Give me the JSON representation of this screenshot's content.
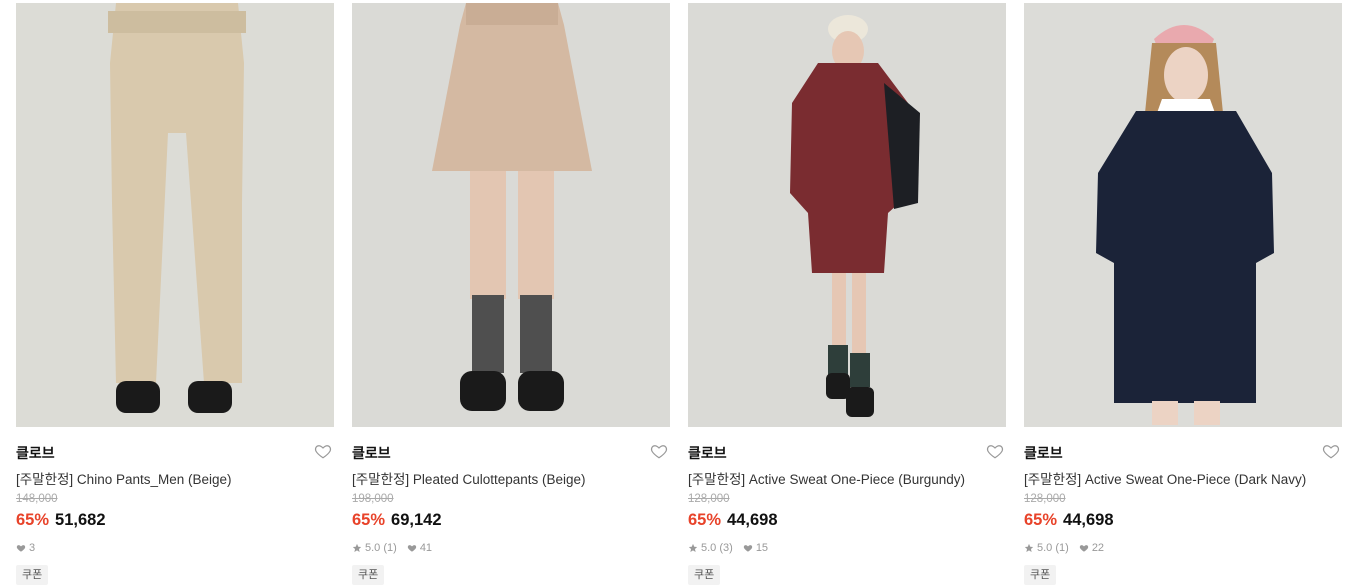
{
  "products": [
    {
      "brand": "클로브",
      "title": "[주말한정] Chino Pants_Men (Beige)",
      "original_price": "148,000",
      "discount": "65%",
      "price": "51,682",
      "rating": "",
      "reviews": "",
      "likes": "3",
      "coupon": "쿠폰",
      "image": "beige-chino-pants-photo"
    },
    {
      "brand": "클로브",
      "title": "[주말한정] Pleated Culottepants (Beige)",
      "original_price": "198,000",
      "discount": "65%",
      "price": "69,142",
      "rating": "5.0",
      "reviews": "(1)",
      "likes": "41",
      "coupon": "쿠폰",
      "image": "beige-pleated-culotte-photo"
    },
    {
      "brand": "클로브",
      "title": "[주말한정] Active Sweat One-Piece (Burgundy)",
      "original_price": "128,000",
      "discount": "65%",
      "price": "44,698",
      "rating": "5.0",
      "reviews": "(3)",
      "likes": "15",
      "coupon": "쿠폰",
      "image": "burgundy-sweat-dress-photo"
    },
    {
      "brand": "클로브",
      "title": "[주말한정] Active Sweat One-Piece (Dark Navy)",
      "original_price": "128,000",
      "discount": "65%",
      "price": "44,698",
      "rating": "5.0",
      "reviews": "(1)",
      "likes": "22",
      "coupon": "쿠폰",
      "image": "navy-sweat-dress-photo"
    }
  ],
  "colors": {
    "discount": "#e8432a",
    "background": "#ffffff",
    "photo_bg": "#dcdcd8"
  },
  "icons": {
    "wishlist": "heart-outline-icon",
    "rating": "star-icon",
    "likes": "heart-filled-icon"
  }
}
